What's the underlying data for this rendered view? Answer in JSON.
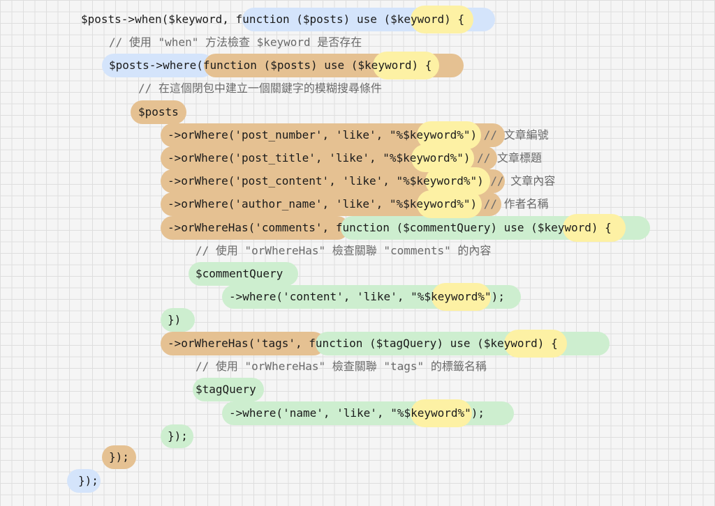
{
  "lines": [
    {
      "text": "$posts->when($keyword, function ($posts) use ($keyword) {",
      "comment": ""
    },
    {
      "text": "// 使用 \"when\" 方法檢查 $keyword 是否存在",
      "comment": ""
    },
    {
      "text": "$posts->where(function ($posts) use ($keyword) {",
      "comment": ""
    },
    {
      "text": "// 在這個閉包中建立一個關鍵字的模糊搜尋條件",
      "comment": ""
    },
    {
      "text": "$posts",
      "comment": ""
    },
    {
      "text": "->orWhere('post_number', 'like', \"%$keyword%\")",
      "comment": " // 文章編號"
    },
    {
      "text": "->orWhere('post_title', 'like', \"%$keyword%\")",
      "comment": " // 文章標題"
    },
    {
      "text": "->orWhere('post_content', 'like', \"%$keyword%\")",
      "comment": " // 文章內容"
    },
    {
      "text": "->orWhere('author_name', 'like', \"%$keyword%\")",
      "comment": " // 作者名稱"
    },
    {
      "text": "->orWhereHas('comments', function ($commentQuery) use ($keyword) {",
      "comment": ""
    },
    {
      "text": "// 使用 \"orWhereHas\" 檢查關聯 \"comments\" 的內容",
      "comment": ""
    },
    {
      "text": "$commentQuery",
      "comment": ""
    },
    {
      "text": "->where('content', 'like', \"%$keyword%\");",
      "comment": ""
    },
    {
      "text": "})",
      "comment": ""
    },
    {
      "text": "->orWhereHas('tags', function ($tagQuery) use ($keyword) {",
      "comment": ""
    },
    {
      "text": "// 使用 \"orWhereHas\" 檢查關聯 \"tags\" 的標籤名稱",
      "comment": ""
    },
    {
      "text": "$tagQuery",
      "comment": ""
    },
    {
      "text": "->where('name', 'like', \"%$keyword%\");",
      "comment": ""
    },
    {
      "text": "});",
      "comment": ""
    },
    {
      "text": "});",
      "comment": ""
    },
    {
      "text": "});",
      "comment": ""
    }
  ],
  "colors": {
    "blue": "#d4e4fb",
    "orange": "#e5c192",
    "green": "#cdeecf",
    "yellow": "#fdf1a4"
  }
}
